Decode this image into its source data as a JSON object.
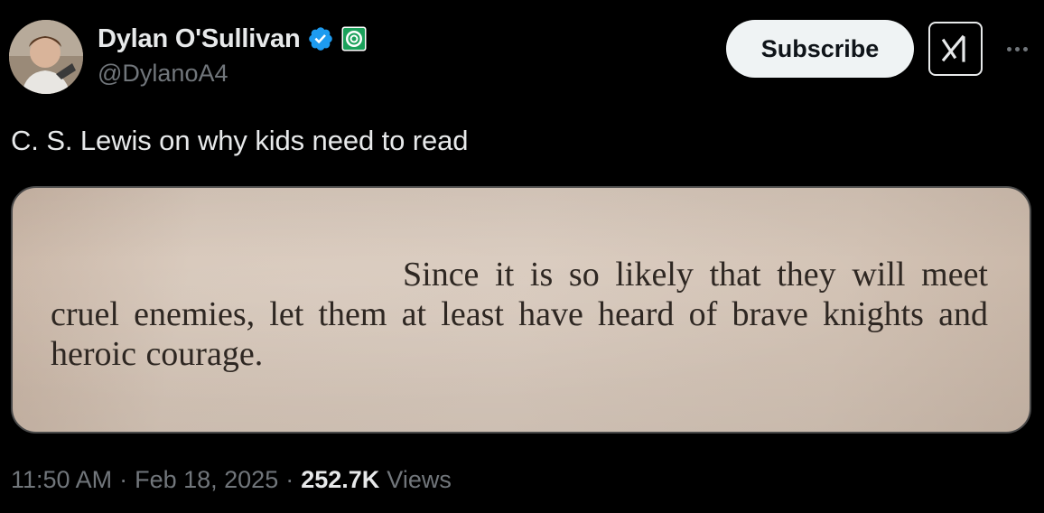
{
  "author": {
    "display_name": "Dylan O'Sullivan",
    "handle": "@DylanoA4",
    "verified": true,
    "avatar_icon": "profile-photo",
    "affiliation_icon": "affiliate-badge-icon"
  },
  "header": {
    "subscribe_label": "Subscribe",
    "grok_icon": "grok-icon",
    "more_icon": "more-icon"
  },
  "tweet": {
    "text": "C. S. Lewis on why kids need to read",
    "image_quote": "Since it is so likely that they will meet cruel enemies, let them at least have heard of brave knights and heroic courage."
  },
  "meta": {
    "time": "11:50 AM",
    "separator": "·",
    "date": "Feb 18, 2025",
    "views_count": "252.7K",
    "views_label": "Views"
  },
  "colors": {
    "background": "#000000",
    "text": "#e7e9ea",
    "secondary": "#71767b",
    "verified_blue": "#1d9bf0",
    "affiliation_green": "#1aa05a"
  }
}
